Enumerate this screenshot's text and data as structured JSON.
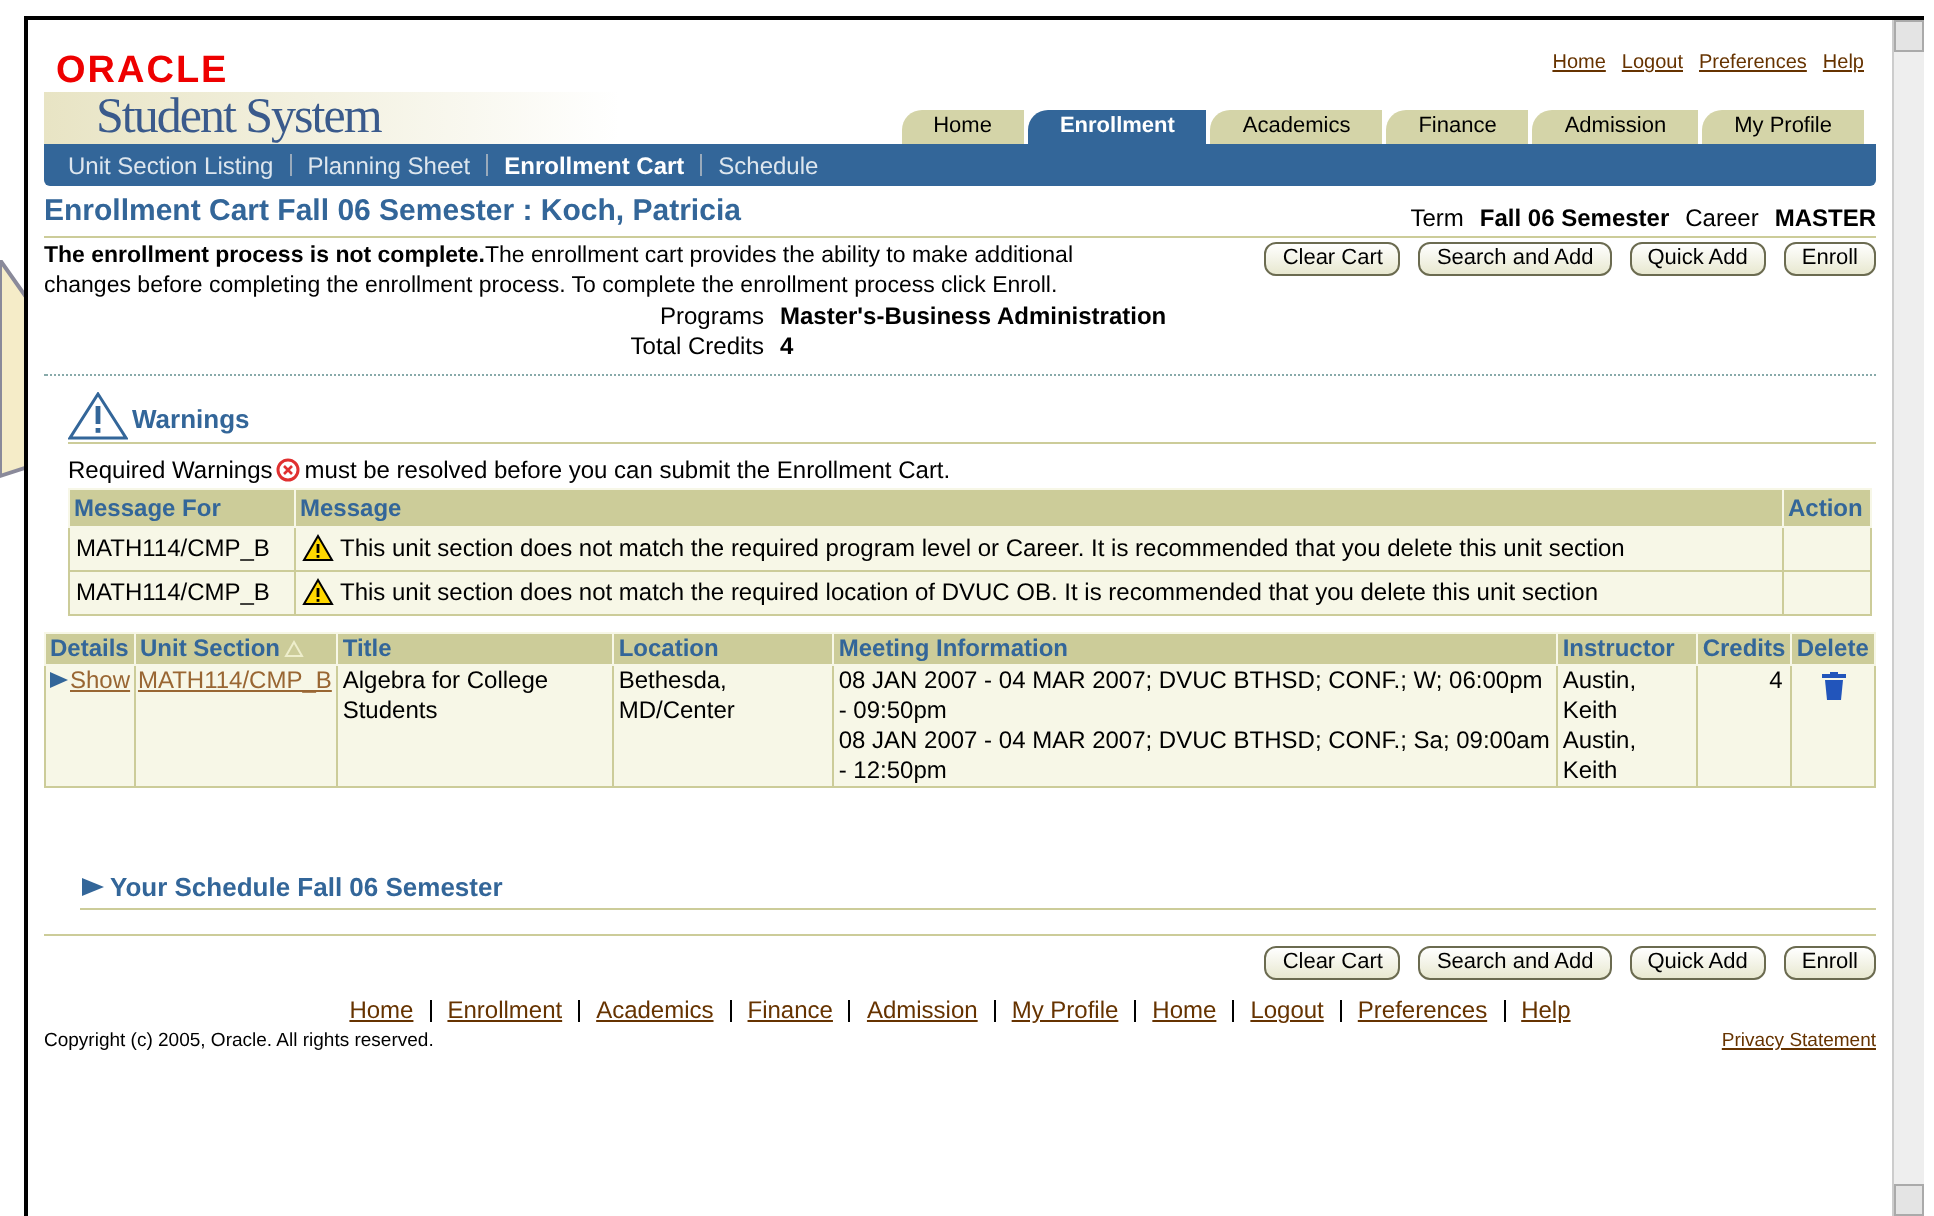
{
  "header": {
    "logo": "ORACLE",
    "product": "Student System",
    "global_links": [
      "Home",
      "Logout",
      "Preferences",
      "Help"
    ]
  },
  "tabs": [
    {
      "label": "Home",
      "selected": false
    },
    {
      "label": "Enrollment",
      "selected": true
    },
    {
      "label": "Academics",
      "selected": false
    },
    {
      "label": "Finance",
      "selected": false
    },
    {
      "label": "Admission",
      "selected": false
    },
    {
      "label": "My Profile",
      "selected": false
    }
  ],
  "subnav": [
    {
      "label": "Unit Section Listing",
      "selected": false
    },
    {
      "label": "Planning Sheet",
      "selected": false
    },
    {
      "label": "Enrollment Cart",
      "selected": true
    },
    {
      "label": "Schedule",
      "selected": false
    }
  ],
  "page_title": "Enrollment Cart Fall 06 Semester : Koch, Patricia",
  "term": {
    "label": "Term",
    "value": "Fall 06 Semester",
    "career_label": "Career",
    "career": "MASTER"
  },
  "intro": "**The enrollment process is not complete.**The enrollment cart provides the ability to make additional changes before completing the enrollment process. To complete the enrollment process click Enroll.",
  "buttons": [
    "Clear Cart",
    "Search and Add",
    "Quick Add",
    "Enroll"
  ],
  "info": [
    {
      "label": "Programs",
      "value": "Master's-Business Administration"
    },
    {
      "label": "Total Credits",
      "value": "4"
    }
  ],
  "warnings": {
    "title": "Warnings",
    "note_before": "Required Warnings",
    "note_after": "must be resolved before you can submit the Enrollment Cart.",
    "columns": [
      "Message For",
      "Message",
      "Action"
    ],
    "rows": [
      {
        "for": "MATH114/CMP_B",
        "message": "This unit section does not match the required program level or Career. It is recommended that you delete this unit section"
      },
      {
        "for": "MATH114/CMP_B",
        "message": "This unit section does not match the required location of DVUC OB. It is recommended that you delete this unit section"
      }
    ]
  },
  "cart": {
    "columns": [
      "Details",
      "Unit Section",
      "Title",
      "Location",
      "Meeting Information",
      "Instructor",
      "Credits",
      "Delete"
    ],
    "rows": [
      {
        "details": "Show",
        "unit_section": "MATH114/CMP_B",
        "title": "Algebra for College Students",
        "location": "Bethesda, MD/Center",
        "meetings": [
          {
            "info": "08 JAN 2007 - 04 MAR 2007; DVUC BTHSD; CONF.; W; 06:00pm - 09:50pm",
            "instructor": "Austin, Keith"
          },
          {
            "info": "08 JAN 2007 - 04 MAR 2007; DVUC BTHSD; CONF.; Sa; 09:00am - 12:50pm",
            "instructor": "Austin, Keith"
          }
        ],
        "credits": "4"
      }
    ]
  },
  "schedule_title": "Your Schedule Fall 06 Semester",
  "bottom_buttons": [
    "Clear Cart",
    "Search and Add",
    "Quick Add",
    "Enroll"
  ],
  "footer_links": [
    "Home",
    "Enrollment",
    "Academics",
    "Finance",
    "Admission",
    "My Profile",
    "Home",
    "Logout",
    "Preferences",
    "Help"
  ],
  "copyright": "Copyright (c) 2005, Oracle. All rights reserved.",
  "privacy": "Privacy Statement"
}
